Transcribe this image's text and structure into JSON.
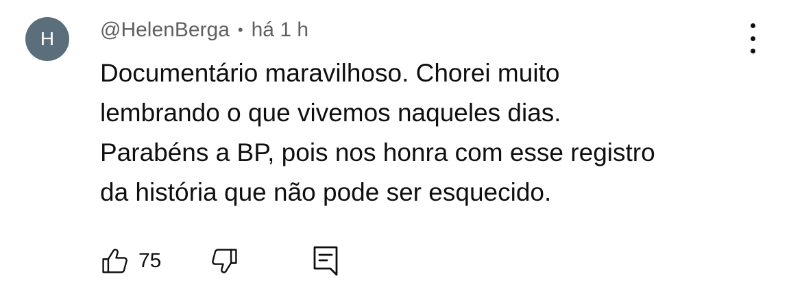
{
  "author": {
    "avatar_letter": "H",
    "avatar_color": "#5a6e7b",
    "handle": "@HelenBerga",
    "separator": "•",
    "timestamp": "há 1 h"
  },
  "comment": {
    "lines": [
      "Documentário maravilhoso. Chorei muito",
      "lembrando o que vivemos naqueles dias.",
      "Parabéns a BP, pois nos honra com esse registro",
      "da história que não pode ser esquecido."
    ]
  },
  "actions": {
    "like_icon": "thumbs-up-icon",
    "like_count": "75",
    "dislike_icon": "thumbs-down-icon",
    "reply_icon": "reply-comment-icon",
    "menu_icon": "more-vertical-icon"
  }
}
